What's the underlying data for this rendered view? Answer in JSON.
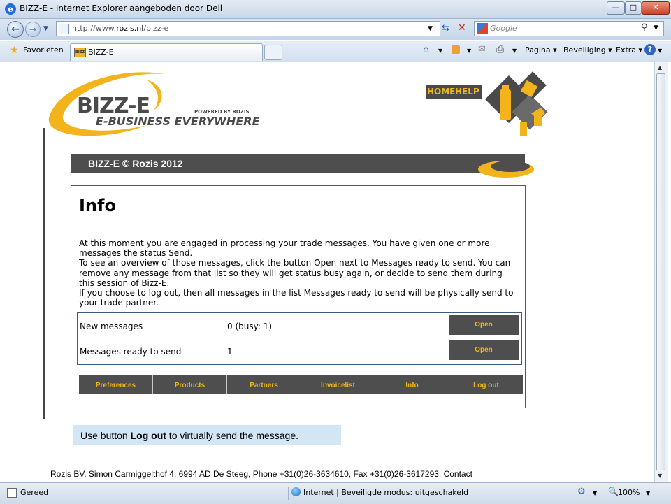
{
  "window": {
    "title": "BIZZ-E - Internet Explorer aangeboden door Dell",
    "ie_icon": "ie-logo-icon",
    "min": "—",
    "max": "□",
    "close": "✕"
  },
  "navbar": {
    "address_prefix": "http://www.",
    "address_domain": "rozis.nl",
    "address_path": "/bizz-e",
    "search_placeholder": "Google"
  },
  "favbar": {
    "favorites_label": "Favorieten",
    "tab_label": "BIZZ-E",
    "tab_icon_text": "BIZZ",
    "pagina": "Pagina",
    "beveiliging": "Beveiliging",
    "extra": "Extra"
  },
  "page": {
    "logo_main": "BIZZ-E",
    "logo_tagline": "E-BUSINESS EVERYWHERE",
    "logo_powered": "POWERED BY ROZIS",
    "header_home": "HOME",
    "header_help": "HELP",
    "banner_text": "BIZZ-E © Rozis 2012",
    "info_title": "Info",
    "info_paragraphs": [
      "At this moment you are engaged in processing your trade messages. You have given one or more messages the status Send.",
      "To see an overview of those messages, click the button Open next to Messages ready to send. You can remove any message from that list so they will get status busy again, or decide to send them during this session of Bizz-E.",
      "If you choose to log out, then all messages in the list Messages ready to send will be physically send to your trade partner."
    ],
    "rows": [
      {
        "label": "New messages",
        "value": "0 (busy: 1)",
        "button": "Open"
      },
      {
        "label": "Messages ready to send",
        "value": "1",
        "button": "Open"
      }
    ],
    "menu": [
      "Preferences",
      "Products",
      "Partners",
      "Invoicelist",
      "Info",
      "Log out"
    ],
    "note_prefix": "Use button ",
    "note_bold": "Log out",
    "note_suffix": " to virtually send the message.",
    "footer": "Rozis BV, Simon Carmiggelthof 4, 6994 AD De Steeg, Phone +31(0)26-3634610, Fax +31(0)26-3617293, Contact"
  },
  "status": {
    "left": "Gereed",
    "zone": "Internet | Beveiligde modus: uitgeschakeld",
    "zoom": "100%"
  },
  "colors": {
    "accent_yellow": "#f2b41a",
    "dark_gray": "#4e4e4e",
    "note_bg": "#d2e6f6"
  }
}
